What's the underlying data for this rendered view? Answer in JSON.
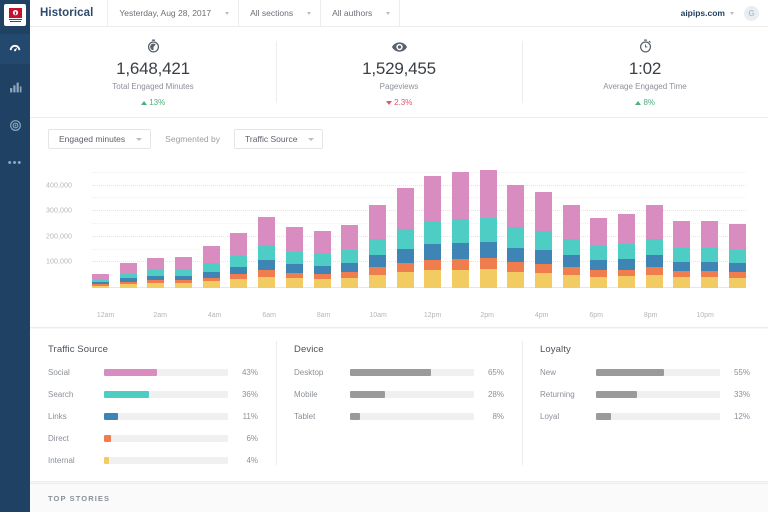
{
  "sidebar": {
    "logo_name": "parsely-logo",
    "items": [
      {
        "name": "dashboard",
        "icon": "speedometer-icon",
        "active": true
      },
      {
        "name": "analytics",
        "icon": "bar-chart-icon",
        "active": false
      },
      {
        "name": "targets",
        "icon": "target-icon",
        "active": false
      },
      {
        "name": "more",
        "icon": "more-dots-icon",
        "active": false,
        "glyph": "•••"
      }
    ]
  },
  "header": {
    "title": "Historical",
    "date_filter": "Yesterday, Aug 28, 2017",
    "sections_filter": "All sections",
    "authors_filter": "All authors",
    "domain": "aipips.com",
    "avatar_initial": "G"
  },
  "kpis": [
    {
      "icon": "engaged-minutes-icon",
      "value": "1,648,421",
      "label": "Total Engaged Minutes",
      "delta": "13%",
      "direction": "up"
    },
    {
      "icon": "eye-icon",
      "value": "1,529,455",
      "label": "Pageviews",
      "delta": "2.3%",
      "direction": "down"
    },
    {
      "icon": "stopwatch-icon",
      "value": "1:02",
      "label": "Average Engaged Time",
      "delta": "8%",
      "direction": "up"
    }
  ],
  "chart_controls": {
    "metric": "Engaged minutes",
    "segmented_by_label": "Segmented by",
    "segment": "Traffic Source"
  },
  "chart_data": {
    "type": "bar",
    "stacked": true,
    "title": "",
    "xlabel": "",
    "ylabel": "",
    "ylim": [
      0,
      500000
    ],
    "yticks": [
      100000,
      200000,
      300000,
      400000
    ],
    "ytick_labels": [
      "100,000",
      "200,000",
      "300,000",
      "400,000"
    ],
    "grid": true,
    "legend": "none",
    "x": [
      "12am",
      "1am",
      "2am",
      "3am",
      "4am",
      "5am",
      "6am",
      "7am",
      "8am",
      "9am",
      "10am",
      "11am",
      "12pm",
      "1pm",
      "2pm",
      "3pm",
      "4pm",
      "5pm",
      "6pm",
      "7pm",
      "8pm",
      "9pm",
      "10pm",
      "11pm"
    ],
    "xtick_labels": [
      "12am",
      "2am",
      "4am",
      "6am",
      "8am",
      "10am",
      "12pm",
      "2pm",
      "4pm",
      "6pm",
      "8pm",
      "10pm"
    ],
    "xtick_indices": [
      0,
      2,
      4,
      6,
      8,
      10,
      12,
      14,
      16,
      18,
      20,
      22
    ],
    "series": [
      {
        "name": "Internal",
        "color": "#f2cc63",
        "values": [
          9000,
          16000,
          19000,
          20000,
          26000,
          34000,
          44000,
          38000,
          36000,
          40000,
          52000,
          62000,
          70000,
          72000,
          74000,
          64000,
          60000,
          52000,
          44000,
          46000,
          52000,
          42000,
          42000,
          40000
        ]
      },
      {
        "name": "Direct",
        "color": "#ef7d4e",
        "values": [
          5000,
          9000,
          11000,
          11000,
          15000,
          20000,
          25000,
          22000,
          20000,
          23000,
          30000,
          36000,
          40000,
          41000,
          42000,
          37000,
          34000,
          30000,
          25000,
          26000,
          30000,
          24000,
          24000,
          23000
        ]
      },
      {
        "name": "Links",
        "color": "#3e85b5",
        "values": [
          8000,
          14000,
          17000,
          17000,
          23000,
          30000,
          39000,
          34000,
          31000,
          35000,
          46000,
          55000,
          62000,
          64000,
          65000,
          57000,
          53000,
          46000,
          39000,
          41000,
          46000,
          37000,
          37000,
          35000
        ]
      },
      {
        "name": "Search",
        "color": "#4ecdc4",
        "values": [
          11000,
          20000,
          24000,
          24000,
          33000,
          43000,
          56000,
          48000,
          45000,
          50000,
          65000,
          78000,
          88000,
          91000,
          93000,
          81000,
          75000,
          65000,
          55000,
          58000,
          65000,
          53000,
          53000,
          50000
        ]
      },
      {
        "name": "Social",
        "color": "#d98cc0",
        "values": [
          21000,
          40000,
          48000,
          48000,
          66000,
          87000,
          113000,
          98000,
          89000,
          100000,
          132000,
          158000,
          178000,
          184000,
          187000,
          163000,
          152000,
          132000,
          112000,
          117000,
          132000,
          106000,
          106000,
          101000
        ]
      }
    ],
    "totals": [
      54000,
      99000,
      119000,
      120000,
      163000,
      214000,
      277000,
      240000,
      221000,
      248000,
      325000,
      389000,
      438000,
      452000,
      461000,
      402000,
      374000,
      325000,
      275000,
      288000,
      325000,
      262000,
      262000,
      249000
    ]
  },
  "breakdowns": [
    {
      "title": "Traffic Source",
      "colored": true,
      "rows": [
        {
          "label": "Social",
          "pct": "43%",
          "value": 43,
          "color": "#d98cc0"
        },
        {
          "label": "Search",
          "pct": "36%",
          "value": 36,
          "color": "#4ecdc4"
        },
        {
          "label": "Links",
          "pct": "11%",
          "value": 11,
          "color": "#3e85b5"
        },
        {
          "label": "Direct",
          "pct": "6%",
          "value": 6,
          "color": "#ef7d4e"
        },
        {
          "label": "Internal",
          "pct": "4%",
          "value": 4,
          "color": "#f2cc63"
        }
      ]
    },
    {
      "title": "Device",
      "colored": false,
      "rows": [
        {
          "label": "Desktop",
          "pct": "65%",
          "value": 65,
          "color": "#9a9a9a"
        },
        {
          "label": "Mobile",
          "pct": "28%",
          "value": 28,
          "color": "#9a9a9a"
        },
        {
          "label": "Tablet",
          "pct": "8%",
          "value": 8,
          "color": "#9a9a9a"
        }
      ]
    },
    {
      "title": "Loyalty",
      "colored": false,
      "rows": [
        {
          "label": "New",
          "pct": "55%",
          "value": 55,
          "color": "#9a9a9a"
        },
        {
          "label": "Returning",
          "pct": "33%",
          "value": 33,
          "color": "#9a9a9a"
        },
        {
          "label": "Loyal",
          "pct": "12%",
          "value": 12,
          "color": "#9a9a9a"
        }
      ]
    }
  ],
  "top_stories": {
    "title": "TOP STORIES"
  }
}
